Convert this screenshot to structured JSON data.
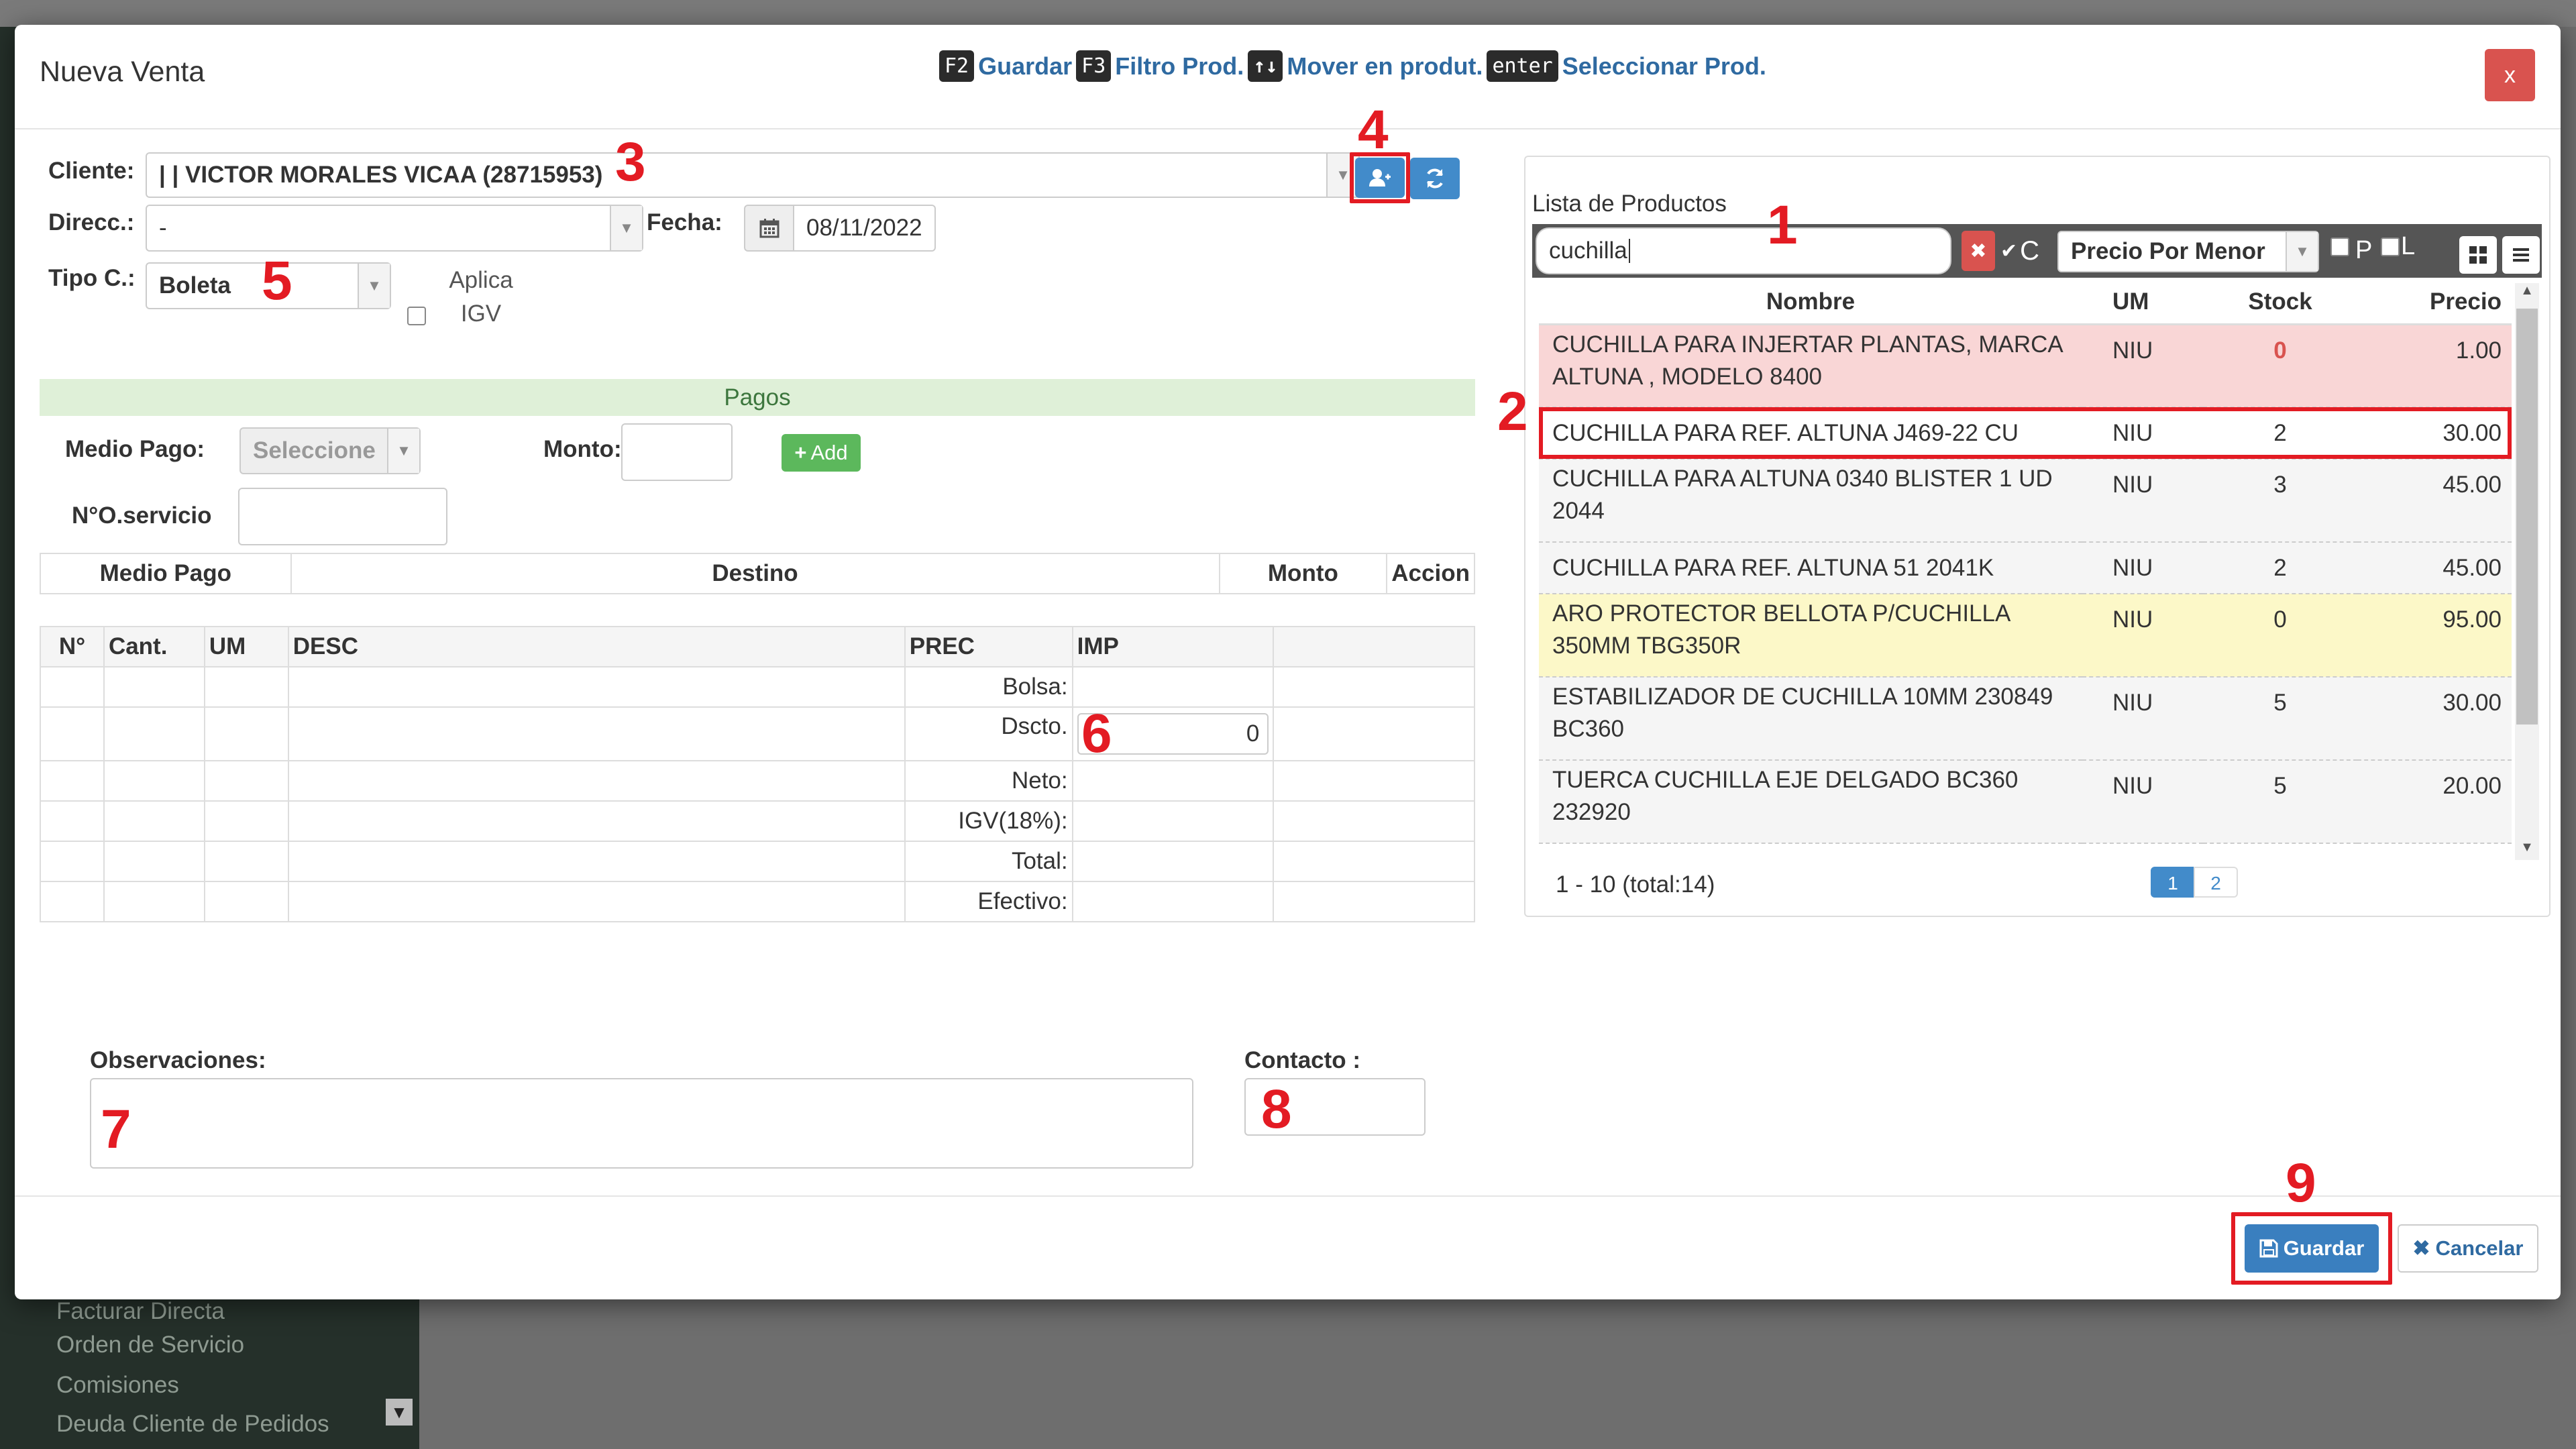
{
  "background": {
    "sidebar_items": [
      "Facturar Directa",
      "Orden de Servicio",
      "Comisiones",
      "Deuda Cliente de Pedidos"
    ]
  },
  "modal": {
    "title": "Nueva Venta",
    "close_label": "x",
    "shortcuts": [
      {
        "key": "F2",
        "label": "Guardar"
      },
      {
        "key": "F3",
        "label": "Filtro Prod."
      },
      {
        "key": "↑↓",
        "label": "Mover en produt."
      },
      {
        "key": "enter",
        "label": "Seleccionar Prod."
      }
    ]
  },
  "form": {
    "cliente_label": "Cliente:",
    "cliente_value": "| | VICTOR MORALES VICAA (28715953)",
    "direcc_label": "Direcc.:",
    "direcc_value": "-",
    "fecha_label": "Fecha:",
    "fecha_value": "08/11/2022",
    "tipo_label": "Tipo C.:",
    "tipo_value": "Boleta",
    "aplica_igv_label": "Aplica IGV",
    "aplica_igv_checked": false
  },
  "pagos": {
    "title": "Pagos",
    "medio_pago_label": "Medio Pago:",
    "medio_pago_value": "Seleccione",
    "monto_label": "Monto:",
    "monto_value": "",
    "add_label": "Add",
    "nro_servicio_label": "N°O.servicio",
    "nro_servicio_value": "",
    "columns": [
      "Medio Pago",
      "Destino",
      "Monto",
      "Accion"
    ]
  },
  "items_table": {
    "columns": [
      "N°",
      "Cant.",
      "UM",
      "DESC",
      "PREC",
      "IMP"
    ],
    "totals": [
      {
        "label": "Bolsa:",
        "value": ""
      },
      {
        "label": "Dscto.",
        "value": "0"
      },
      {
        "label": "Neto:",
        "value": ""
      },
      {
        "label": "IGV(18%):",
        "value": ""
      },
      {
        "label": "Total:",
        "value": ""
      },
      {
        "label": "Efectivo:",
        "value": ""
      }
    ]
  },
  "footer_fields": {
    "observaciones_label": "Observaciones:",
    "observaciones_value": "",
    "contacto_label": "Contacto :",
    "contacto_value": ""
  },
  "buttons": {
    "guardar": "Guardar",
    "cancelar": "Cancelar"
  },
  "productos": {
    "title": "Lista de Productos",
    "search_value": "cuchilla",
    "check_c_label": "C",
    "price_mode": "Precio Por Menor",
    "check_p_label": "P",
    "check_l_label": "L",
    "columns": [
      "Nombre",
      "UM",
      "Stock",
      "Precio"
    ],
    "rows": [
      {
        "nombre": "CUCHILLA PARA INJERTAR PLANTAS, MARCA ALTUNA , MODELO 8400",
        "um": "NIU",
        "stock": "0",
        "precio": "1.00",
        "style": "red"
      },
      {
        "nombre": "CUCHILLA PARA REF. ALTUNA J469-22 CU",
        "um": "NIU",
        "stock": "2",
        "precio": "30.00",
        "style": "white"
      },
      {
        "nombre": "CUCHILLA PARA ALTUNA 0340 BLISTER 1 UD 2044",
        "um": "NIU",
        "stock": "3",
        "precio": "45.00",
        "style": "gray"
      },
      {
        "nombre": "CUCHILLA PARA REF. ALTUNA 51 2041K",
        "um": "NIU",
        "stock": "2",
        "precio": "45.00",
        "style": "gray"
      },
      {
        "nombre": "ARO PROTECTOR BELLOTA P/CUCHILLA 350MM TBG350R",
        "um": "NIU",
        "stock": "0",
        "precio": "95.00",
        "style": "yellow"
      },
      {
        "nombre": "ESTABILIZADOR DE CUCHILLA 10MM 230849 BC360",
        "um": "NIU",
        "stock": "5",
        "precio": "30.00",
        "style": "gray"
      },
      {
        "nombre": "TUERCA CUCHILLA EJE DELGADO BC360 232920",
        "um": "NIU",
        "stock": "5",
        "precio": "20.00",
        "style": "gray"
      }
    ],
    "pagination_info": "1 - 10 (total:14)",
    "pages": [
      "1",
      "2"
    ]
  },
  "annotations": [
    "1",
    "2",
    "3",
    "4",
    "5",
    "6",
    "7",
    "8",
    "9"
  ]
}
